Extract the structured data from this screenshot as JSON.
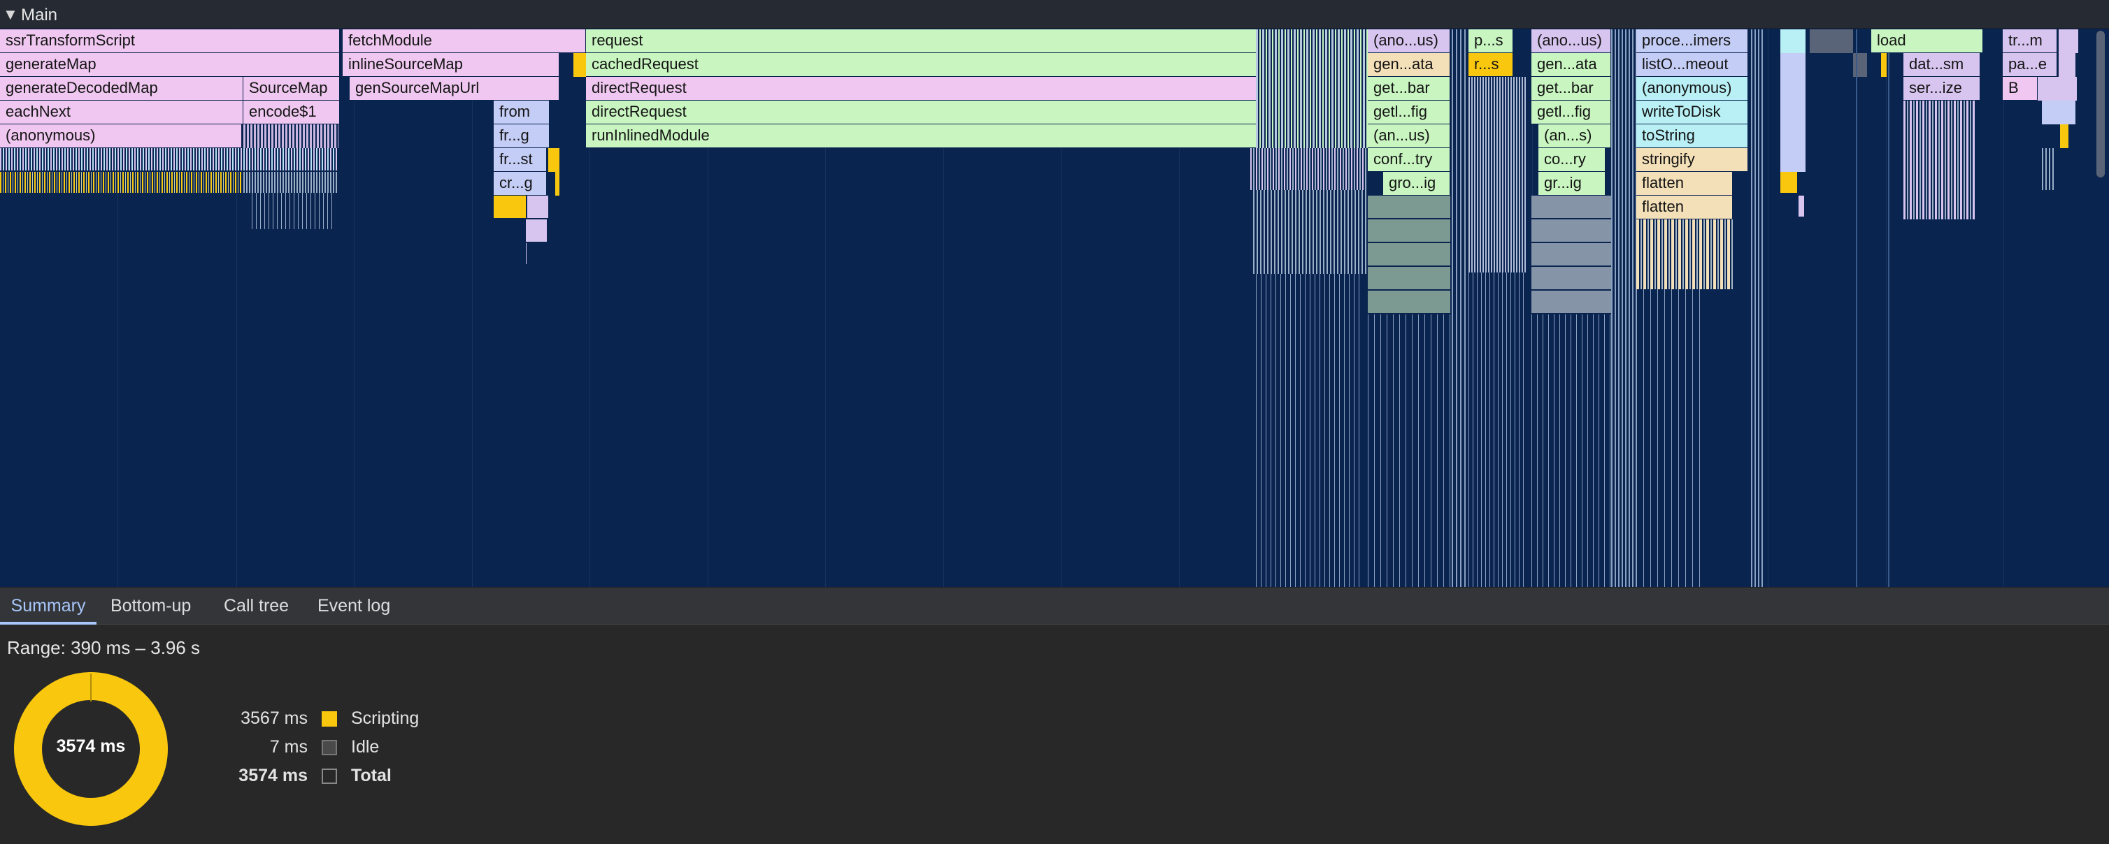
{
  "track": {
    "title": "Main"
  },
  "frames": {
    "ssrTransformScript": "ssrTransformScript",
    "generateMap": "generateMap",
    "generateDecodedMap": "generateDecodedMap",
    "eachNext": "eachNext",
    "anonymous": "(anonymous)",
    "sourceMap": "SourceMap",
    "encode1": "encode$1",
    "fetchModule": "fetchModule",
    "inlineSourceMap": "inlineSourceMap",
    "genSourceMapUrl": "genSourceMapUrl",
    "from": "from",
    "frg": "fr...g",
    "frst": "fr...st",
    "crg": "cr...g",
    "request": "request",
    "cachedRequest": "cachedRequest",
    "directRequest1": "directRequest",
    "directRequest2": "directRequest",
    "runInlinedModule": "runInlinedModule",
    "anous1": "(ano...us)",
    "genata1": "gen...ata",
    "getbar1": "get...bar",
    "getlfig1": "getl...fig",
    "anus1": "(an...us)",
    "conftry": "conf...try",
    "groig": "gro...ig",
    "ps": "p...s",
    "rs": "r...s",
    "anous2": "(ano...us)",
    "genata2": "gen...ata",
    "getbar2": "get...bar",
    "getlfig2": "getl...fig",
    "ans2": "(an...s)",
    "cory": "co...ry",
    "grig": "gr...ig",
    "proceimers": "proce...imers",
    "listomeout": "listO...meout",
    "anonymous2": "(anonymous)",
    "writeToDisk": "writeToDisk",
    "toString": "toString",
    "stringify": "stringify",
    "flatten1": "flatten",
    "flatten2": "flatten",
    "load": "load",
    "datsm": "dat...sm",
    "serize": "ser...ize",
    "trm": "tr...m",
    "pae": "pa...e",
    "b": "B"
  },
  "tabs": {
    "summary": "Summary",
    "bottom_up": "Bottom-up",
    "call_tree": "Call tree",
    "event_log": "Event log"
  },
  "summary": {
    "range": "Range: 390 ms – 3.96 s",
    "donut_total": "3574 ms",
    "scripting_ms": 3567,
    "idle_ms": 7,
    "rows": [
      {
        "value": "3567 ms",
        "label": "Scripting",
        "color": "#f9c80e"
      },
      {
        "value": "7 ms",
        "label": "Idle",
        "color": "#4a4a4a"
      },
      {
        "value": "3574 ms",
        "label": "Total",
        "color": "#282828"
      }
    ]
  },
  "colors": {
    "pink": "#efc7f0",
    "green": "#c8f5c0",
    "yellow": "#f9c80e",
    "blue": "#c4cdf5",
    "cyan": "#b8f0f5",
    "tan": "#f3dfb8",
    "lavender": "#d7c4ef",
    "background": "#0a2450",
    "accent": "#a8c7fa"
  }
}
